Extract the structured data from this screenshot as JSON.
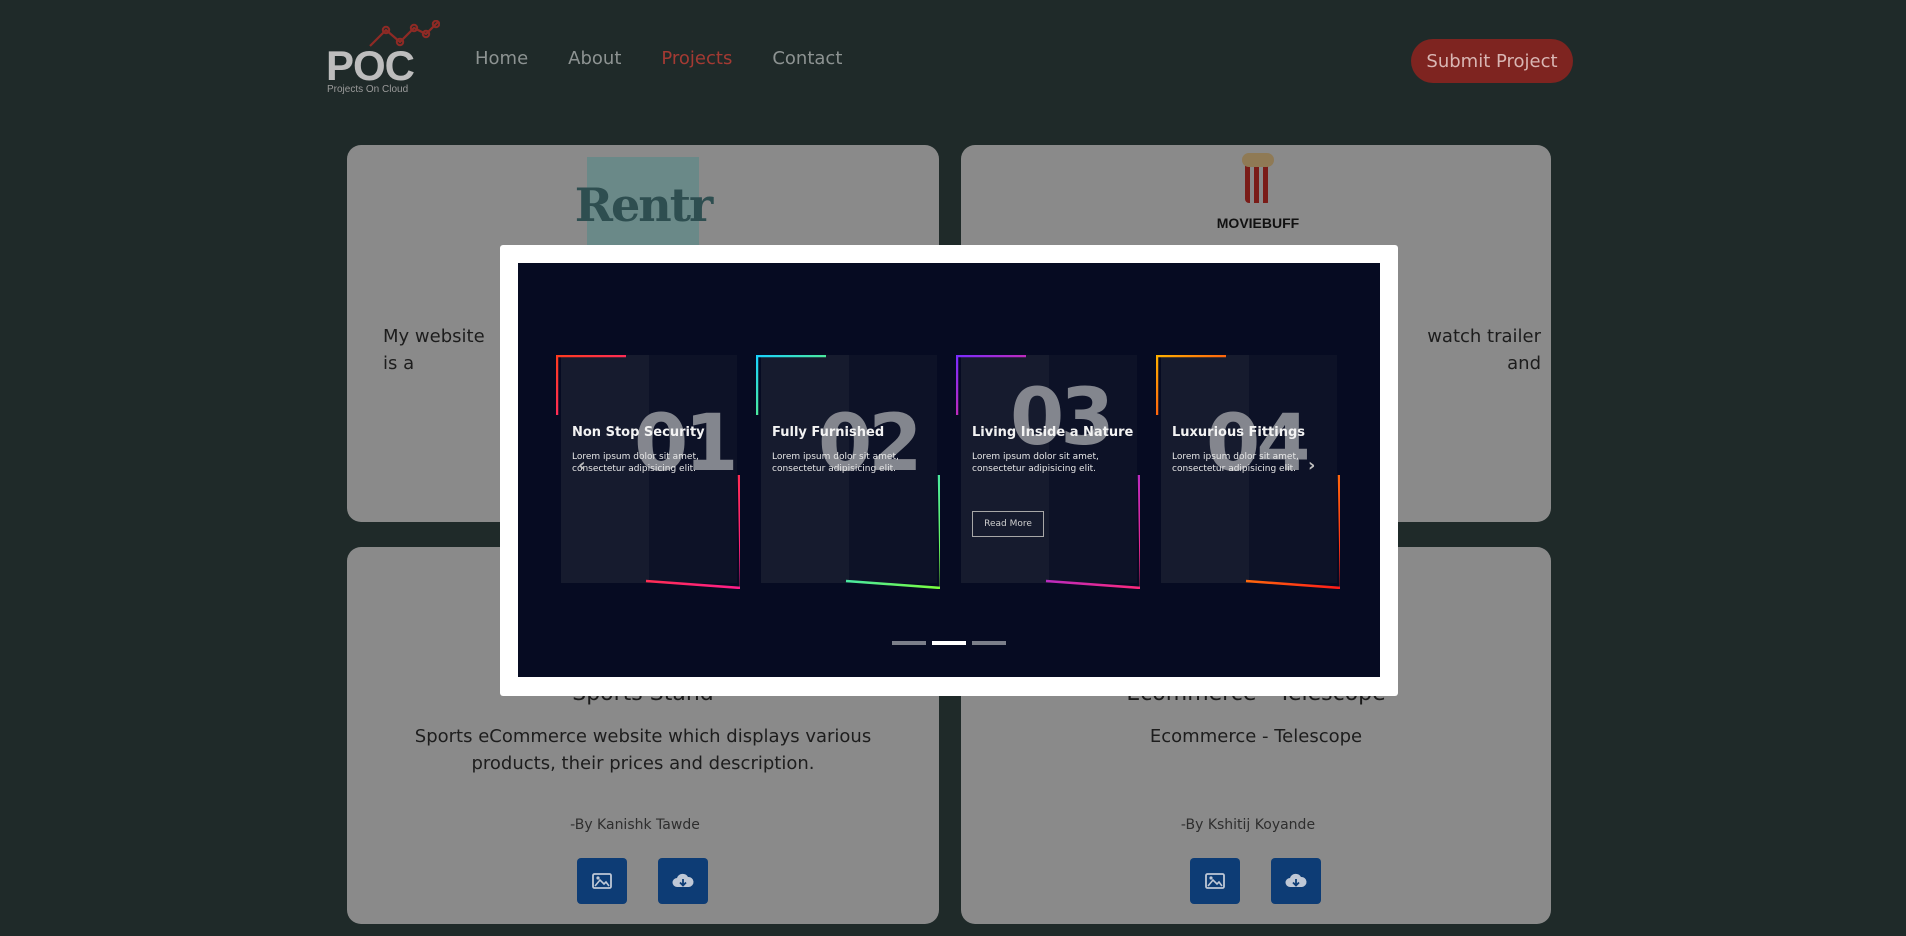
{
  "logo": {
    "text": "POC",
    "tagline": "Projects On Cloud"
  },
  "nav": {
    "items": [
      "Home",
      "About",
      "Projects",
      "Contact"
    ],
    "active": "Projects"
  },
  "header": {
    "submit_label": "Submit Project"
  },
  "cards": [
    {
      "logo_text": "Rentr",
      "desc": "My website is a"
    },
    {
      "logo_text": "MOVIEBUFF",
      "desc": "watch trailer and"
    },
    {
      "title": "Sports Stand",
      "desc": "Sports eCommerce website which displays various products, their prices and description.",
      "author": "-By Kanishk Tawde"
    },
    {
      "title": "Ecommerce - Telescope",
      "desc": "Ecommerce - Telescope",
      "author": "-By Kshitij Koyande"
    }
  ],
  "modal": {
    "features": [
      {
        "num": "01",
        "title": "Non Stop Security",
        "text": "Lorem ipsum dolor sit amet, consectetur adipisicing elit."
      },
      {
        "num": "02",
        "title": "Fully Furnished",
        "text": "Lorem ipsum dolor sit amet, consectetur adipisicing elit."
      },
      {
        "num": "03",
        "title": "Living Inside a Nature",
        "text": "Lorem ipsum dolor sit amet, consectetur adipisicing elit.",
        "button": "Read More"
      },
      {
        "num": "04",
        "title": "Luxurious Fittings",
        "text": "Lorem ipsum dolor sit amet, consectetur adipisicing elit."
      }
    ],
    "prev_icon": "‹",
    "next_icon": "›",
    "active_dot": 1,
    "accent_colors": [
      "#ff3b30",
      "#ff1e8c",
      "#19d3ff",
      "#7dff3b",
      "#7b2cff",
      "#ff2a7a",
      "#ffb000",
      "#ff1a1a"
    ]
  }
}
